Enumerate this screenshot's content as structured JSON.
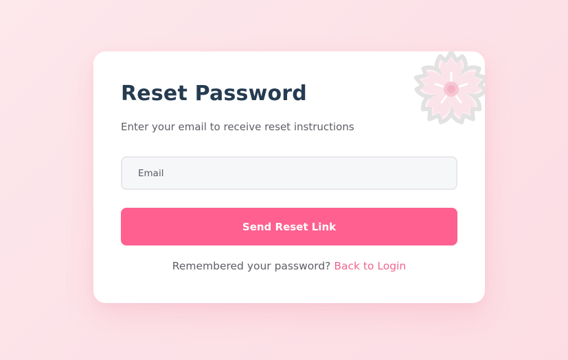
{
  "form": {
    "title": "Reset Password",
    "subtitle": "Enter your email to receive reset instructions",
    "email_placeholder": "Email",
    "email_value": "",
    "submit_label": "Send Reset Link",
    "footer_text": "Remembered your password?",
    "footer_link": "Back to Login"
  },
  "decoration": {
    "icon": "cherry-blossom-icon"
  },
  "colors": {
    "accent": "#ff6090",
    "link": "#f0658f",
    "title": "#253b50",
    "background": "#fde8ec"
  }
}
